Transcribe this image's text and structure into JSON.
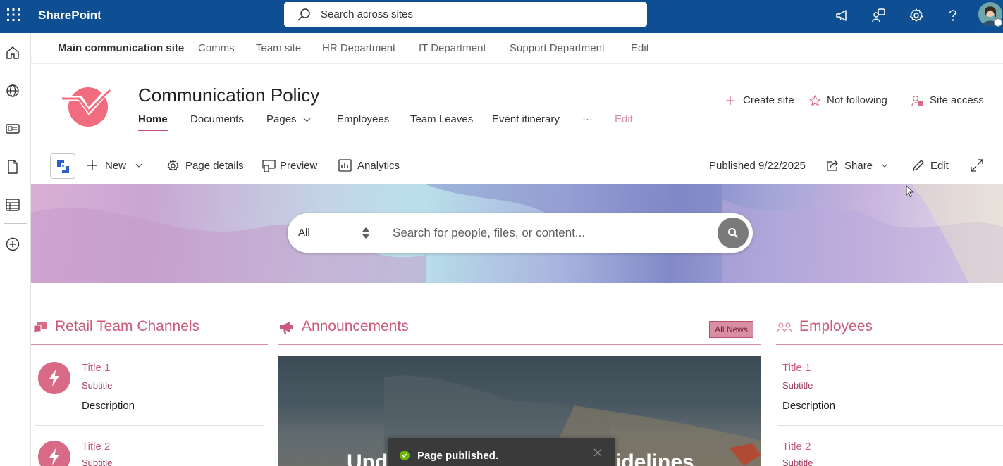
{
  "suite": {
    "brand": "SharePoint",
    "search_placeholder": "Search across sites"
  },
  "hub_nav": {
    "main": "Main communication site",
    "items": [
      "Comms",
      "Team site",
      "HR Department",
      "IT Department",
      "Support Department",
      "Edit"
    ]
  },
  "site": {
    "title": "Communication Policy",
    "nav": [
      "Home",
      "Documents",
      "Pages",
      "Employees",
      "Team Leaves",
      "Event itinerary",
      "···",
      "Edit"
    ],
    "actions": {
      "create_site": "Create site",
      "following": "Not following",
      "site_access": "Site access"
    }
  },
  "command_bar": {
    "new": "New",
    "page_details": "Page details",
    "preview": "Preview",
    "analytics": "Analytics",
    "published": "Published 9/22/2025",
    "share": "Share",
    "edit": "Edit"
  },
  "hero_search": {
    "scope": "All",
    "placeholder": "Search for people, files, or content..."
  },
  "retail": {
    "title": "Retail Team Channels",
    "items": [
      {
        "title": "Title 1",
        "subtitle": "Subtitle",
        "description": "Description"
      },
      {
        "title": "Title 2",
        "subtitle": "Subtitle"
      }
    ]
  },
  "announcements": {
    "title": "Announcements",
    "all_news": "All News",
    "headline_left": "Und",
    "headline_right": "idelines"
  },
  "employees": {
    "title": "Employees",
    "items": [
      {
        "title": "Title 1",
        "subtitle": "Subtitle",
        "description": "Description"
      },
      {
        "title": "Title 2",
        "subtitle": "Subtitle"
      }
    ]
  },
  "toast": {
    "message": "Page published."
  },
  "colors": {
    "suite_bar": "#0d4f92",
    "accent": "#cc5a7a",
    "toast_success": "#6bb700"
  }
}
